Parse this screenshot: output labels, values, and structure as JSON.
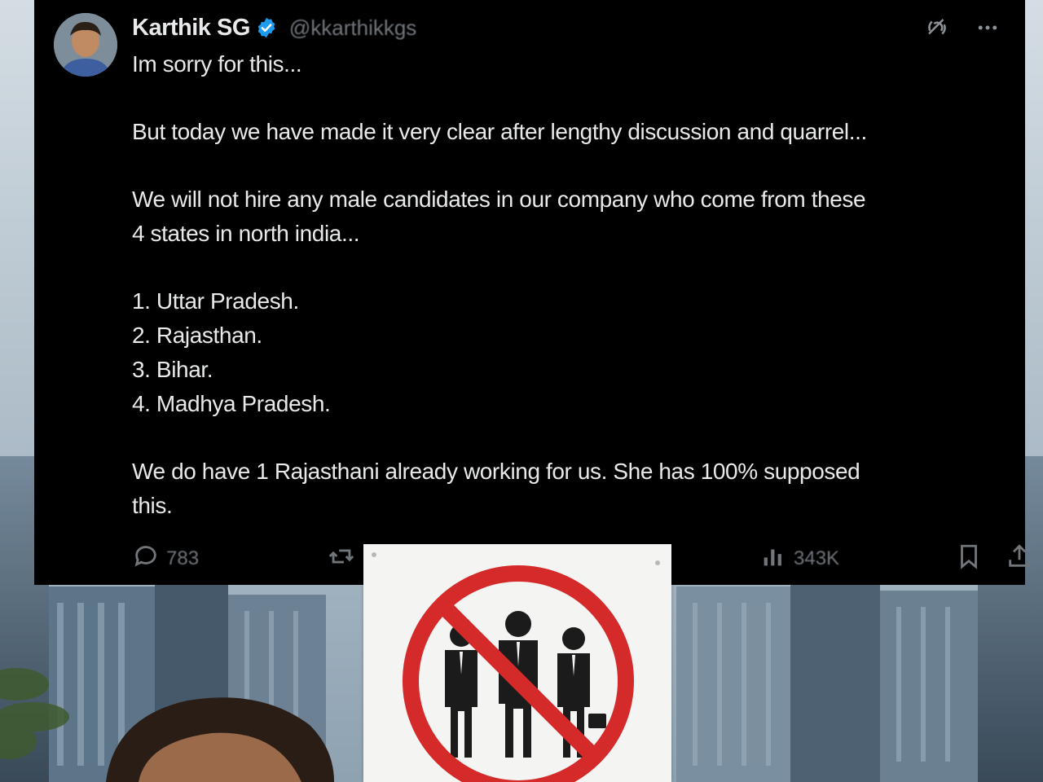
{
  "tweet": {
    "author": {
      "display_name": "Karthik SG",
      "handle": "@kkarthikkgs",
      "verified": true
    },
    "body": {
      "line1": "Im sorry for this...",
      "line2": "But today we have made it very clear after lengthy discussion and quarrel...",
      "line3": "We will not hire any male candidates in our company who come from these",
      "line4": "4 states in north india...",
      "list": [
        "1. Uttar Pradesh.",
        "2. Rajasthan.",
        "3. Bihar.",
        "4. Madhya Pradesh."
      ],
      "line5": "We do have 1 Rajasthani already working for us. She has 100% supposed",
      "line6": "this."
    },
    "stats": {
      "replies": "783",
      "views": "343K"
    },
    "icons": {
      "verified": "verified-badge-icon",
      "grok": "grok-icon",
      "more": "more-icon",
      "reply": "reply-icon",
      "retweet": "retweet-icon",
      "views": "views-icon",
      "bookmark": "bookmark-icon",
      "share": "share-icon"
    }
  },
  "colors": {
    "card_bg": "#000000",
    "text": "#e7e9ea",
    "muted": "#71767b",
    "verified": "#1d9bf0",
    "sign_red": "#d42a2a"
  }
}
